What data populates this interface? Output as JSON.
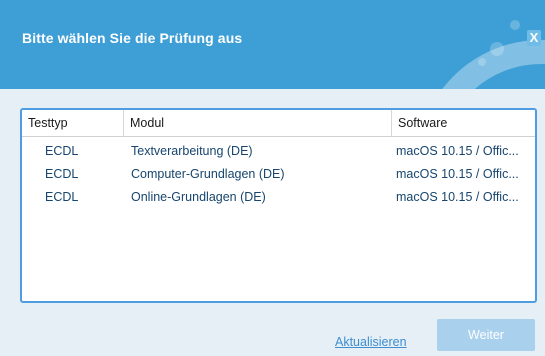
{
  "dialog": {
    "title": "Bitte wählen Sie die Prüfung aus",
    "close_label": "X"
  },
  "table": {
    "columns": [
      "Testtyp",
      "Modul",
      "Software"
    ],
    "rows": [
      [
        "ECDL",
        "Textverarbeitung (DE)",
        "macOS 10.15 / Offic..."
      ],
      [
        "ECDL",
        "Computer-Grundlagen (DE)",
        "macOS 10.15 / Offic..."
      ],
      [
        "ECDL",
        "Online-Grundlagen (DE)",
        "macOS 10.15 / Offic..."
      ]
    ]
  },
  "footer": {
    "refresh_label": "Aktualisieren",
    "next_label": "Weiter"
  },
  "colors": {
    "header": "#3e9fd6",
    "accent": "#4d9de0",
    "link": "#3d8fd1",
    "button_disabled": "#a9d1ee"
  }
}
